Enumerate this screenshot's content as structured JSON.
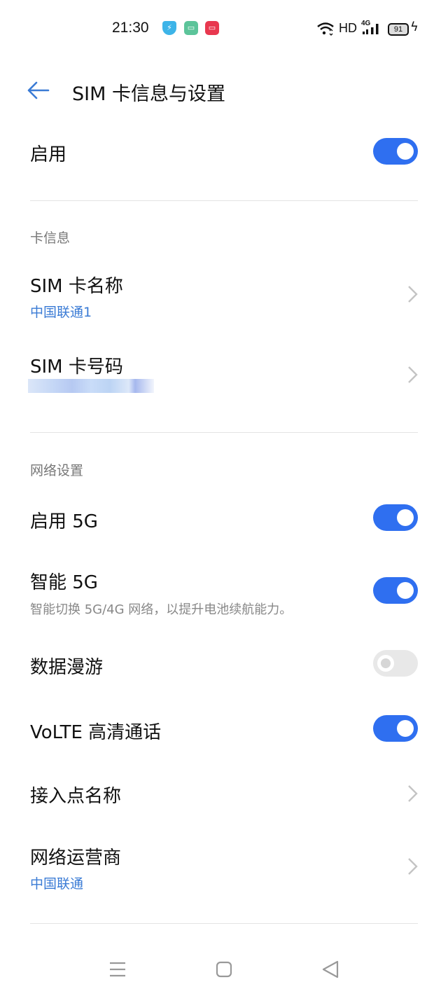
{
  "status_bar": {
    "time": "21:30",
    "notification_icons": [
      "shield-bolt-icon",
      "message-icon",
      "screen-record-icon"
    ],
    "network_label": "HD",
    "cellular_label": "4G",
    "battery_level": "91",
    "charging": true
  },
  "header": {
    "back_icon": "arrow-left-icon",
    "title": "SIM 卡信息与设置"
  },
  "enable": {
    "label": "启用",
    "on": true
  },
  "card_info": {
    "section_title": "卡信息",
    "sim_name": {
      "label": "SIM 卡名称",
      "value": "中国联通1"
    },
    "sim_number": {
      "label": "SIM 卡号码",
      "value_blurred": true
    }
  },
  "network_settings": {
    "section_title": "网络设置",
    "enable_5g": {
      "label": "启用 5G",
      "on": true
    },
    "smart_5g": {
      "label": "智能 5G",
      "description": "智能切换 5G/4G 网络，以提升电池续航能力。",
      "on": true
    },
    "data_roaming": {
      "label": "数据漫游",
      "on": false
    },
    "volte": {
      "label": "VoLTE 高清通话",
      "on": true
    },
    "apn": {
      "label": "接入点名称"
    },
    "operator": {
      "label": "网络运营商",
      "value": "中国联通"
    }
  },
  "colors": {
    "accent": "#2f6ff0",
    "link_blue": "#3a7bd5",
    "toggle_off": "#e8e8e8"
  },
  "nav_bar": [
    "menu-icon",
    "home-icon",
    "back-triangle-icon"
  ]
}
